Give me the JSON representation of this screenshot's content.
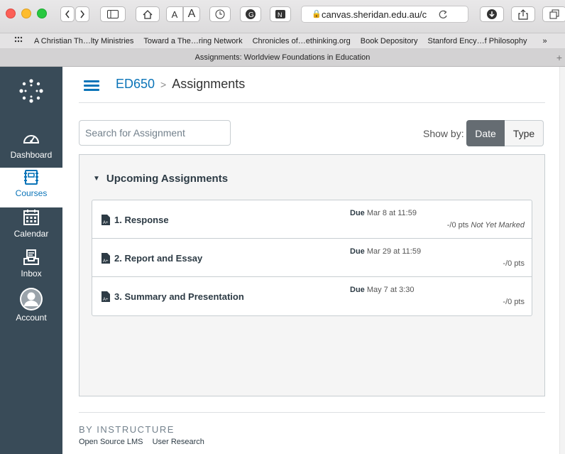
{
  "browser": {
    "url": "canvas.sheridan.edu.au/c",
    "tab_title": "Assignments: Worldview Foundations in Education",
    "text_size_small": "A",
    "text_size_large": "A",
    "new_tab": "+",
    "bookmarks": [
      "A Christian Th…lty Ministries",
      "Toward a The…ring Network",
      "Chronicles of…ethinking.org",
      "Book Depository",
      "Stanford Ency…f Philosophy"
    ],
    "bookmarks_overflow": "»"
  },
  "sidebar": {
    "items": [
      {
        "label": "Dashboard",
        "icon": "dashboard-icon"
      },
      {
        "label": "Courses",
        "icon": "courses-icon"
      },
      {
        "label": "Calendar",
        "icon": "calendar-icon"
      },
      {
        "label": "Inbox",
        "icon": "inbox-icon"
      },
      {
        "label": "Account",
        "icon": "account-icon"
      }
    ]
  },
  "breadcrumb": {
    "course": "ED650",
    "separator": ">",
    "current": "Assignments"
  },
  "search": {
    "placeholder": "Search for Assignment"
  },
  "show_by": {
    "label": "Show by:",
    "date": "Date",
    "type": "Type"
  },
  "group": {
    "caret": "▼",
    "title": "Upcoming Assignments"
  },
  "assignments": [
    {
      "title": "1. Response",
      "due_label": "Due",
      "due_date": "Mar 8 at 11:59",
      "points": "-/0 pts",
      "status": "Not Yet Marked"
    },
    {
      "title": "2. Report and Essay",
      "due_label": "Due",
      "due_date": "Mar 29 at 11:59",
      "points": "-/0 pts",
      "status": ""
    },
    {
      "title": "3. Summary and Presentation",
      "due_label": "Due",
      "due_date": "May 7 at 3:30",
      "points": "-/0 pts",
      "status": ""
    }
  ],
  "footer": {
    "brand": "BY INSTRUCTURE",
    "links": [
      "Open Source LMS",
      "User Research"
    ]
  },
  "colors": {
    "sidebar_bg": "#394b58",
    "link": "#0b74b8",
    "date_button": "#656c72"
  }
}
